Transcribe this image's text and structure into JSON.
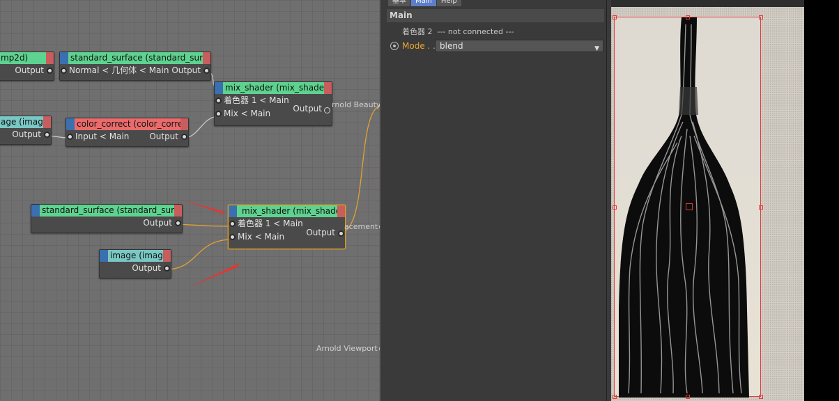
{
  "nodes": {
    "image_place2d": {
      "title": "mp2d)",
      "out": "Output"
    },
    "std_surface_top": {
      "title": "standard_surface (standard_surface)",
      "in": "Normal < 几何体 < Main",
      "out": "Output",
      "pre": "n"
    },
    "mix_shader_top": {
      "title": "mix_shader (mix_shader)",
      "in1": "着色器 1 < Main",
      "in2": "Mix < Main",
      "out": "Output"
    },
    "image_left": {
      "title": "age (image)",
      "out": "Output"
    },
    "color_correct": {
      "title": "color_correct (color_correct)",
      "in": "Input < Main",
      "out": "Output"
    },
    "std_surface_bottom": {
      "title": "standard_surface (standard_surface)",
      "out": "Output"
    },
    "mix_shader_selected": {
      "title": "mix_shader (mix_shader)",
      "in1": "着色器 1 < Main",
      "in2": "Mix < Main",
      "out": "Output"
    },
    "image_bottom": {
      "title": "image (image)",
      "out": "Output"
    }
  },
  "external_ports": {
    "beauty": "rnold Beauty",
    "displacement": "acement",
    "viewport": "Arnold Viewport"
  },
  "attr_panel": {
    "tabs": [
      "基本",
      "Main",
      "Help"
    ],
    "section": "Main",
    "shader2_label": "着色器 2",
    "shader2_value": "--- not connected ---",
    "mode_label": "Mode . .",
    "mode_value": "blend"
  },
  "colors": {
    "selection": "#e0a020",
    "annotation_arrow": "#e8352e",
    "wire": "#e3a232"
  }
}
